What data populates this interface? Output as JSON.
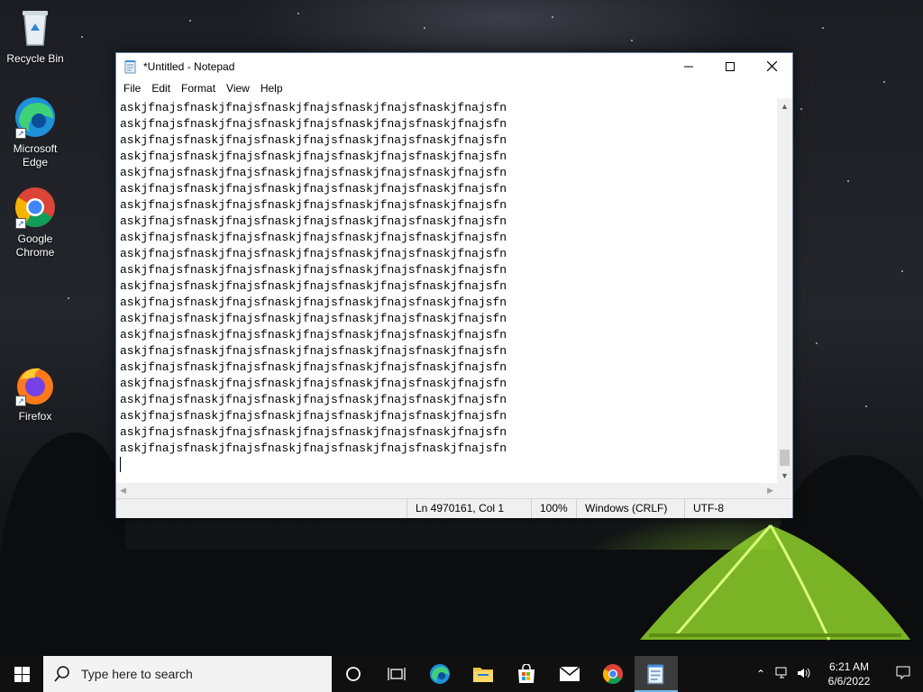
{
  "desktop": {
    "icons": [
      {
        "label": "Recycle Bin",
        "icon": "recycle-bin-icon"
      },
      {
        "label": "Microsoft Edge",
        "icon": "edge-icon"
      },
      {
        "label": "Google Chrome",
        "icon": "chrome-icon"
      },
      {
        "label": "Firefox",
        "icon": "firefox-icon"
      }
    ]
  },
  "notepad": {
    "title": "*Untitled - Notepad",
    "menu": [
      "File",
      "Edit",
      "Format",
      "View",
      "Help"
    ],
    "line_text": "askjfnajsfnaskjfnajsfnaskjfnajsfnaskjfnajsfnaskjfnajsfn",
    "visible_line_count": 22,
    "status": {
      "position": "Ln 4970161, Col 1",
      "zoom": "100%",
      "line_ending": "Windows (CRLF)",
      "encoding": "UTF-8"
    },
    "colors": {
      "border": "#6f8fb6",
      "statusbar": "#f0f0f0"
    }
  },
  "taskbar": {
    "search_placeholder": "Type here to search",
    "apps": [
      "cortana-icon",
      "task-view-icon",
      "edge-icon",
      "file-explorer-icon",
      "store-icon",
      "mail-icon",
      "chrome-icon",
      "notepad-icon"
    ],
    "active_app": "notepad-icon",
    "clock": {
      "time": "6:21 AM",
      "date": "6/6/2022"
    },
    "colors": {
      "background": "#101010",
      "active_indicator": "#76b9ed"
    }
  }
}
